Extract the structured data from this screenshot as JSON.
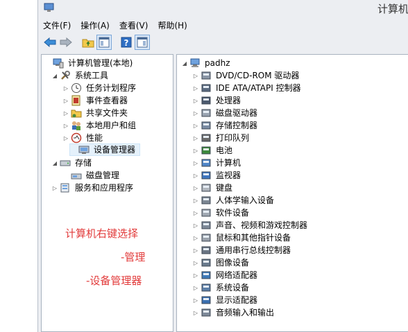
{
  "window": {
    "title": "计算机"
  },
  "menu": [
    "文件(F)",
    "操作(A)",
    "查看(V)",
    "帮助(H)"
  ],
  "toolbar": [
    {
      "name": "back-arrow-icon"
    },
    {
      "name": "forward-arrow-icon"
    },
    {
      "name": "up-folder-icon"
    },
    {
      "name": "show-hide-tree-icon"
    },
    {
      "name": "help-icon"
    },
    {
      "name": "action-pane-icon"
    }
  ],
  "left_tree": [
    {
      "label": "计算机管理(本地)",
      "icon": "computer-management-icon",
      "expander": ""
    },
    {
      "label": "系统工具",
      "icon": "system-tools-icon",
      "expander": "◢"
    },
    {
      "label": "任务计划程序",
      "icon": "task-scheduler-icon",
      "expander": "▷"
    },
    {
      "label": "事件查看器",
      "icon": "event-viewer-icon",
      "expander": "▷"
    },
    {
      "label": "共享文件夹",
      "icon": "shared-folders-icon",
      "expander": "▷"
    },
    {
      "label": "本地用户和组",
      "icon": "local-users-icon",
      "expander": "▷"
    },
    {
      "label": "性能",
      "icon": "performance-icon",
      "expander": "▷"
    },
    {
      "label": "设备管理器",
      "icon": "device-manager-icon",
      "expander": ""
    },
    {
      "label": "存储",
      "icon": "storage-icon",
      "expander": "◢"
    },
    {
      "label": "磁盘管理",
      "icon": "disk-management-icon",
      "expander": ""
    },
    {
      "label": "服务和应用程序",
      "icon": "services-apps-icon",
      "expander": "▷"
    }
  ],
  "right_tree": {
    "root": {
      "label": "padhz",
      "icon": "computer-icon",
      "expander": "◢"
    },
    "items": [
      {
        "label": "DVD/CD-ROM 驱动器",
        "icon": "dvd-drive-icon"
      },
      {
        "label": "IDE ATA/ATAPI 控制器",
        "icon": "ide-controller-icon"
      },
      {
        "label": "处理器",
        "icon": "processor-icon"
      },
      {
        "label": "磁盘驱动器",
        "icon": "disk-drive-icon"
      },
      {
        "label": "存储控制器",
        "icon": "storage-controller-icon"
      },
      {
        "label": "打印队列",
        "icon": "print-queue-icon"
      },
      {
        "label": "电池",
        "icon": "battery-icon"
      },
      {
        "label": "计算机",
        "icon": "computer-icon"
      },
      {
        "label": "监视器",
        "icon": "monitor-icon"
      },
      {
        "label": "键盘",
        "icon": "keyboard-icon"
      },
      {
        "label": "人体学输入设备",
        "icon": "hid-icon"
      },
      {
        "label": "软件设备",
        "icon": "software-device-icon"
      },
      {
        "label": "声音、视频和游戏控制器",
        "icon": "sound-icon"
      },
      {
        "label": "鼠标和其他指针设备",
        "icon": "mouse-icon"
      },
      {
        "label": "通用串行总线控制器",
        "icon": "usb-icon"
      },
      {
        "label": "图像设备",
        "icon": "imaging-icon"
      },
      {
        "label": "网络适配器",
        "icon": "network-adapter-icon"
      },
      {
        "label": "系统设备",
        "icon": "system-device-icon"
      },
      {
        "label": "显示适配器",
        "icon": "display-adapter-icon"
      },
      {
        "label": "音频输入和输出",
        "icon": "audio-io-icon"
      }
    ]
  },
  "annotations": [
    "计算机右键选择",
    "-管理",
    "-设备管理器"
  ],
  "colors": {
    "annotation": "#e23b3b",
    "window_bg": "#eceef2",
    "selection": "#e5f1fb"
  }
}
